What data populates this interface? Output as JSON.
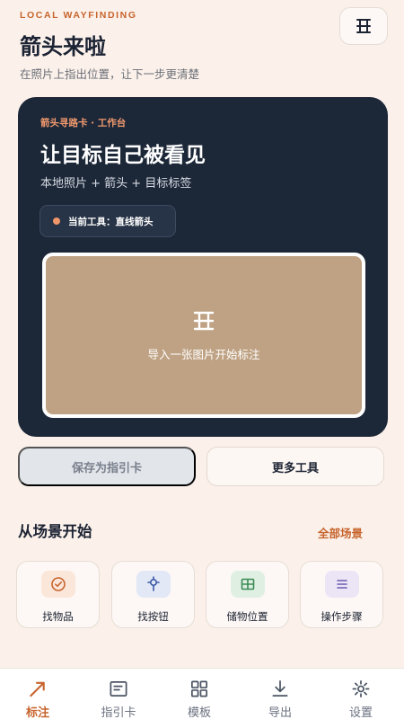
{
  "header": {
    "eyebrow": "LOCAL WAYFINDING",
    "title": "箭头来啦",
    "subtitle": "在照片上指出位置，让下一步更清楚",
    "corner_icon": "image-add-icon"
  },
  "card": {
    "eyebrow": "箭头寻路卡 · 工作台",
    "title": "让目标自己被看见",
    "subtitle": "本地照片 + 箭头 + 目标标签",
    "tool_chip": "当前工具：直线箭头",
    "drop_label": "导入一张图片开始标注"
  },
  "actions": {
    "save_label": "保存为指引卡",
    "more_label": "更多工具"
  },
  "scenes": {
    "title": "从场景开始",
    "all_link": "全部场景",
    "items": [
      {
        "label": "找物品",
        "icon": "check-circle-icon",
        "color": "#c7642d",
        "bg": "#fbe6da"
      },
      {
        "label": "找按钮",
        "icon": "target-icon",
        "color": "#3d5aa8",
        "bg": "#e2e8f6"
      },
      {
        "label": "储物位置",
        "icon": "grid-icon",
        "color": "#3b8a55",
        "bg": "#dff0e3"
      },
      {
        "label": "操作步骤",
        "icon": "list-icon",
        "color": "#6d5bb0",
        "bg": "#ebe5f6"
      }
    ]
  },
  "tabs": [
    {
      "label": "标注",
      "icon": "arrow-icon",
      "active": true
    },
    {
      "label": "指引卡",
      "icon": "card-icon",
      "active": false
    },
    {
      "label": "模板",
      "icon": "grid-icon",
      "active": false
    },
    {
      "label": "导出",
      "icon": "download-icon",
      "active": false
    },
    {
      "label": "设置",
      "icon": "gear-icon",
      "active": false
    }
  ],
  "colors": {
    "accent": "#c7642d",
    "card_bg": "#1c2738",
    "page_bg": "#fbf1ea",
    "photo_placeholder": "#bfa283"
  }
}
